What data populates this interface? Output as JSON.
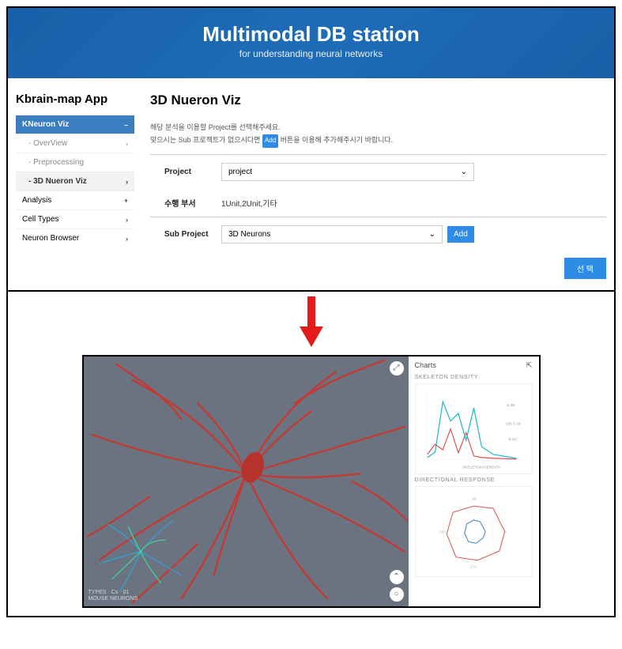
{
  "hero": {
    "title": "Multimodal DB station",
    "subtitle": "for understanding neural networks"
  },
  "sidebar": {
    "title": "Kbrain-map App",
    "items": [
      {
        "label": "KNeuron Viz",
        "chev": "–"
      },
      {
        "label": "- OverView",
        "chev": "›"
      },
      {
        "label": "- Preprocessing"
      },
      {
        "label": "- 3D Nueron Viz",
        "chev": "›"
      },
      {
        "label": "Analysis",
        "chev": "+"
      },
      {
        "label": "Cell Types",
        "chev": "›"
      },
      {
        "label": "Neuron Browser",
        "chev": "›"
      }
    ]
  },
  "main": {
    "title": "3D Nueron Viz",
    "hint1": "해당 분석을 이용할 Project를 선택해주세요.",
    "hint2_pre": "맞으시는 Sub 프로젝트가 없으시다면",
    "hint2_badge": "Add",
    "hint2_post": "버튼을 이용해 추가해주시기 바랍니다.",
    "project_label": "Project",
    "project_value": "project",
    "dept_label": "수행 부서",
    "dept_value": "1Unit,2Unit,기타",
    "subproject_label": "Sub Project",
    "subproject_value": "3D Neurons",
    "add_btn": "Add",
    "submit_btn": "선 택"
  },
  "viz": {
    "caption_line1": "TYPES · Cs · 01",
    "caption_line2": "MOUSE NEURONS"
  },
  "charts": {
    "heading": "Charts",
    "chart1_label": "SKELETON DENSITY",
    "chart1_xlabel": "SKELETON DENSITY",
    "chart2_label": "DIRECTIONAL RESPONSE"
  },
  "chart_data": [
    {
      "type": "line",
      "title": "SKELETON DENSITY",
      "xlabel": "SKELETON DENSITY",
      "ylabel": "",
      "x": [
        -3,
        -2,
        -1,
        0,
        1,
        2,
        3,
        4,
        5,
        6
      ],
      "series": [
        {
          "name": "red",
          "color": "#d9534f",
          "values": [
            0.1,
            0.3,
            0.2,
            0.5,
            0.1,
            0.4,
            0.05,
            0.02,
            0.01,
            0.01
          ]
        },
        {
          "name": "cyan",
          "color": "#17b6c3",
          "values": [
            0.02,
            0.1,
            0.9,
            0.6,
            0.7,
            0.3,
            0.8,
            0.2,
            0.1,
            0.02
          ]
        }
      ],
      "annotations": [
        "2.38",
        "195 0.18",
        "0.12"
      ]
    },
    {
      "type": "line",
      "title": "DIRECTIONAL RESPONSE",
      "series": [
        {
          "name": "red",
          "color": "#d9534f",
          "angles_deg": [
            0,
            45,
            90,
            135,
            180,
            225,
            270,
            315
          ],
          "r": [
            0.9,
            0.6,
            0.7,
            0.5,
            0.8,
            0.7,
            0.6,
            0.85
          ]
        },
        {
          "name": "blue",
          "color": "#3a7ebf",
          "angles_deg": [
            0,
            45,
            90,
            135,
            180,
            225,
            270,
            315
          ],
          "r": [
            0.3,
            0.25,
            0.4,
            0.2,
            0.35,
            0.3,
            0.25,
            0.35
          ]
        }
      ]
    }
  ]
}
